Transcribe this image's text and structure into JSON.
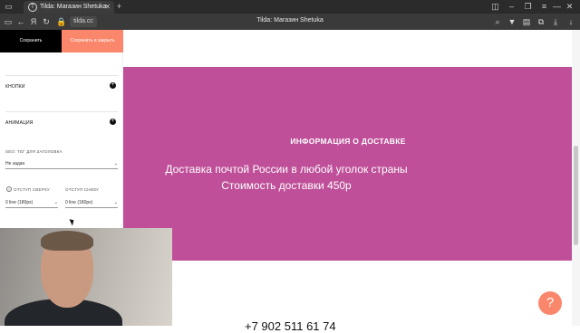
{
  "browser": {
    "tab_title": "Tilda: Магазин Shetuka",
    "tab_close": "✕",
    "new_tab": "+",
    "window_title": "Tilda: Магазин Shetuka",
    "url": "tilda.cc",
    "yandex_icon": "Я"
  },
  "toolbar": {
    "save_label": "Сохранить",
    "save_close_label": "Сохранить и закрыть"
  },
  "settings": {
    "buttons_section": "КНОПКИ",
    "animation_section": "АНИМАЦИЯ",
    "seo_tag_label": "SEO: ТЕГ ДЛЯ ЗАГОЛОВКА",
    "seo_tag_value": "Не задан",
    "padding_top_label": "ОТСТУП СВЕРХУ",
    "padding_top_value": "0 line (180px)",
    "padding_bottom_label": "ОТСТУП СНИЗУ",
    "padding_bottom_value": "0 line (180px)"
  },
  "content": {
    "heading": "ИНФОРМАЦИЯ О ДОСТАВКЕ",
    "line1": "Доставка почтой России в любой уголок страны",
    "line2": "Стоимость доставки 450р",
    "phone": "+7 902 511 61 74",
    "help_button": "?"
  },
  "colors": {
    "promo_bg": "#bf4f99",
    "accent": "#fa876b"
  }
}
